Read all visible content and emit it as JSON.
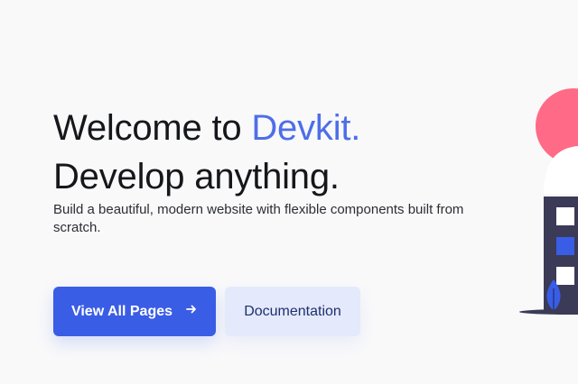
{
  "hero": {
    "title_line1_prefix": "Welcome to ",
    "title_line1_accent": "Devkit.",
    "title_line2": "Develop anything.",
    "subtitle": "Build a beautiful, modern website with flexible components built from scratch."
  },
  "buttons": {
    "primary_label": "View All Pages",
    "primary_icon": "arrow-right-icon",
    "secondary_label": "Documentation"
  },
  "colors": {
    "accent": "#4e6ee8",
    "primary_button": "#3a5de6",
    "secondary_button": "#e4e9fb",
    "background": "#f9f9fa",
    "illustration_pink": "#ff6b86",
    "illustration_dark": "#3b3b57"
  }
}
